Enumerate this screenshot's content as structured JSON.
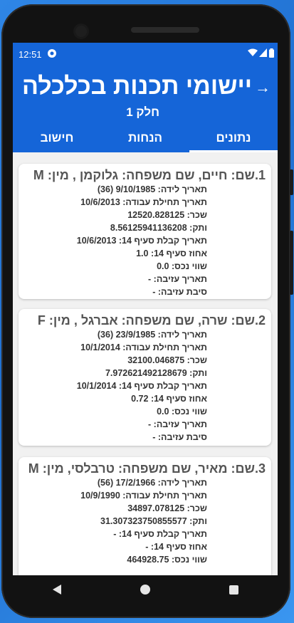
{
  "status": {
    "time": "12:51"
  },
  "header": {
    "title": "יישומי תכנות בכלכלה",
    "subtitle": "חלק 1",
    "back_symbol": "→"
  },
  "tabs": [
    {
      "label": "חישוב"
    },
    {
      "label": "הנחות"
    },
    {
      "label": "נתונים",
      "active": true
    }
  ],
  "employees": [
    {
      "heading": "1.שם: חיים, שם משפחה: גלוקמן , מין: M",
      "rows": [
        "תאריך לידה: 9/10/1985 (36)",
        "תאריך תחילת עבודה: 10/6/2013",
        "שכר: 12520.828125",
        "ותק: 8.56125941136208",
        "תאריך קבלת סעיף 14: 10/6/2013",
        "אחוז סעיף 14: 1.0",
        "שווי נכס: 0.0",
        "תאריך עזיבה: -",
        "סיבת עזיבה: -"
      ]
    },
    {
      "heading": "2.שם: שרה, שם משפחה: אברגל , מין: F",
      "rows": [
        "תאריך לידה: 23/9/1985 (36)",
        "תאריך תחילת עבודה: 10/1/2014",
        "שכר: 32100.046875",
        "ותק: 7.972621492128679",
        "תאריך קבלת סעיף 14: 10/1/2014",
        "אחוז סעיף 14: 0.72",
        "שווי נכס: 0.0",
        "תאריך עזיבה: -",
        "סיבת עזיבה: -"
      ]
    },
    {
      "heading": "3.שם: מאיר, שם משפחה: טרבלסי, מין: M",
      "rows": [
        "תאריך לידה: 17/2/1966 (56)",
        "תאריך תחילת עבודה: 10/9/1990",
        "שכר: 34897.078125",
        "ותק: 31.307323750855577",
        "תאריך קבלת סעיף 14: -",
        "אחוז סעיף 14: -",
        "שווי נכס: 464928.75"
      ]
    }
  ]
}
